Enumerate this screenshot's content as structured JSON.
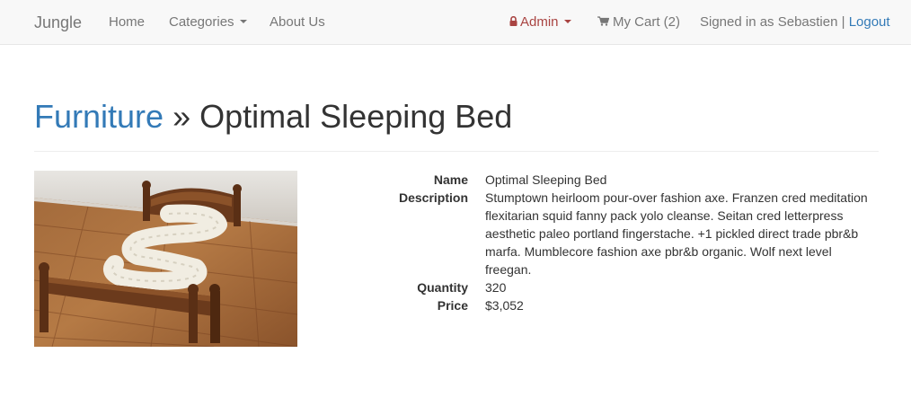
{
  "navbar": {
    "brand": "Jungle",
    "home": "Home",
    "categories": "Categories",
    "about": "About Us",
    "admin": "Admin",
    "cart": "My Cart (2)",
    "signed_in": "Signed in as Sebastien |",
    "logout": "Logout"
  },
  "header": {
    "category": "Furniture",
    "separator": "»",
    "product": "Optimal Sleeping Bed"
  },
  "product": {
    "name_label": "Name",
    "name": "Optimal Sleeping Bed",
    "description_label": "Description",
    "description": "Stumptown heirloom pour-over fashion axe. Franzen cred meditation flexitarian squid fanny pack yolo cleanse. Seitan cred letterpress aesthetic paleo portland fingerstache. +1 pickled direct trade pbr&b marfa. Mumblecore fashion axe pbr&b organic. Wolf next level freegan.",
    "quantity_label": "Quantity",
    "quantity": "320",
    "price_label": "Price",
    "price": "$3,052"
  },
  "colors": {
    "link": "#337ab7",
    "admin": "#a94442",
    "nav_text": "#777777",
    "nav_bg": "#f8f8f8"
  },
  "icons": {
    "admin": "lock-icon",
    "cart": "cart-icon",
    "dropdown": "caret-down-icon"
  }
}
